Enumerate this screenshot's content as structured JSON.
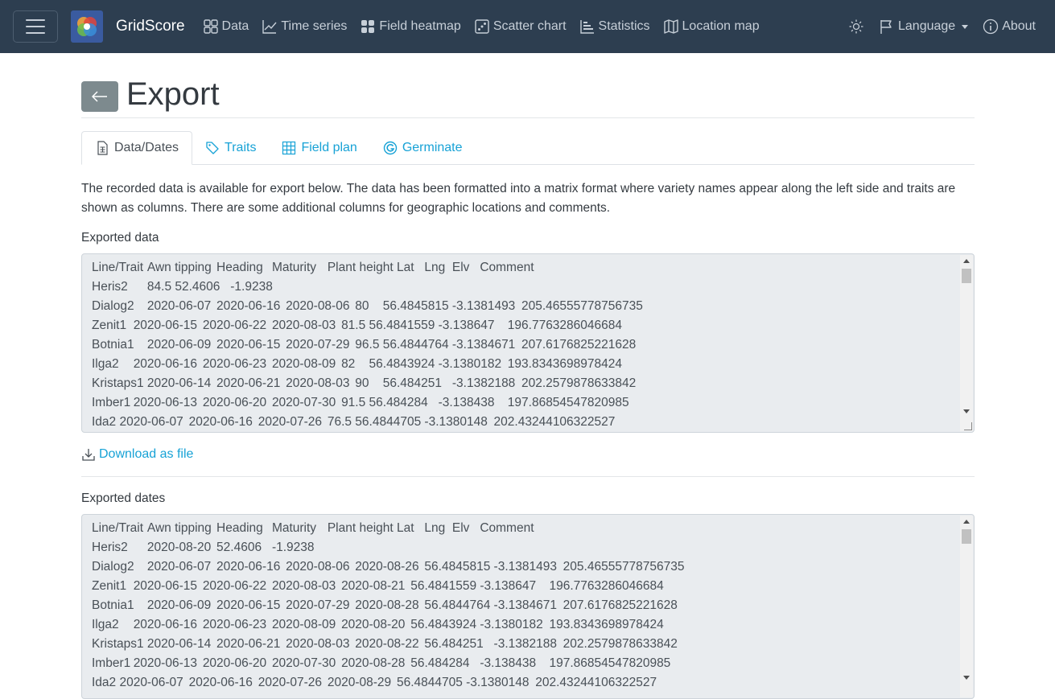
{
  "app": {
    "brand": "GridScore"
  },
  "nav": {
    "items": [
      {
        "label": "Data",
        "icon": "grid-icon"
      },
      {
        "label": "Time series",
        "icon": "line-chart-icon"
      },
      {
        "label": "Field heatmap",
        "icon": "heatmap-icon"
      },
      {
        "label": "Scatter chart",
        "icon": "scatter-icon"
      },
      {
        "label": "Statistics",
        "icon": "statistics-icon"
      },
      {
        "label": "Location map",
        "icon": "map-icon"
      }
    ],
    "language": "Language",
    "about": "About"
  },
  "page": {
    "title": "Export",
    "tabs": [
      {
        "label": "Data/Dates",
        "icon": "file-spreadsheet-icon",
        "active": true
      },
      {
        "label": "Traits",
        "icon": "tags-icon",
        "active": false
      },
      {
        "label": "Field plan",
        "icon": "table-icon",
        "active": false
      },
      {
        "label": "Germinate",
        "icon": "germinate-icon",
        "active": false
      }
    ],
    "description": "The recorded data is available for export below. The data has been formatted into a matrix format where variety names appear along the left side and traits are shown as columns. There are some additional columns for geographic locations and comments.",
    "exported_data_label": "Exported data",
    "exported_data_text": "Line/Trait\tAwn tipping\tHeading\tMaturity\tPlant height\tLat\tLng\tElv\tComment\nHeris2\t\t84.5\t52.4606\t-1.9238\nDialog2\t2020-06-07\t2020-06-16\t2020-08-06\t80\t56.4845815\t-3.1381493\t205.46555778756735\nZenit1\t2020-06-15\t2020-06-22\t2020-08-03\t81.5\t56.4841559\t-3.138647\t196.7763286046684\nBotnia1\t2020-06-09\t2020-06-15\t2020-07-29\t96.5\t56.4844764\t-3.1384671\t207.6176825221628\nIlga2\t2020-06-16\t2020-06-23\t2020-08-09\t82\t56.4843924\t-3.1380182\t193.8343698978424\nKristaps1\t2020-06-14\t2020-06-21\t2020-08-03\t90\t56.484251\t-3.1382188\t202.2579878633842\nImber1\t2020-06-13\t2020-06-20\t2020-07-30\t91.5\t56.484284\t-3.138438\t197.86854547820985\nIda2\t2020-06-07\t2020-06-16\t2020-07-26\t76.5\t56.4844705\t-3.1380148\t202.43244106322527",
    "download_label": "Download as file",
    "exported_dates_label": "Exported dates",
    "exported_dates_text": "Line/Trait\tAwn tipping\tHeading\tMaturity\tPlant height\tLat\tLng\tElv\tComment\nHeris2\t\t2020-08-20\t52.4606\t-1.9238\nDialog2\t2020-06-07\t2020-06-16\t2020-08-06\t2020-08-26\t56.4845815\t-3.1381493\t205.46555778756735\nZenit1\t2020-06-15\t2020-06-22\t2020-08-03\t2020-08-21\t56.4841559\t-3.138647\t196.7763286046684\nBotnia1\t2020-06-09\t2020-06-15\t2020-07-29\t2020-08-28\t56.4844764\t-3.1384671\t207.6176825221628\nIlga2\t2020-06-16\t2020-06-23\t2020-08-09\t2020-08-20\t56.4843924\t-3.1380182\t193.8343698978424\nKristaps1\t2020-06-14\t2020-06-21\t2020-08-03\t2020-08-22\t56.484251\t-3.1382188\t202.2579878633842\nImber1\t2020-06-13\t2020-06-20\t2020-07-30\t2020-08-28\t56.484284\t-3.138438\t197.86854547820985\nIda2\t2020-06-07\t2020-06-16\t2020-07-26\t2020-08-29\t56.4844705\t-3.1380148\t202.43244106322527"
  },
  "colors": {
    "navbar": "#2d3e50",
    "link": "#17a2d6",
    "back_button": "#7d8a8e",
    "textarea_bg": "#e9ecef"
  }
}
